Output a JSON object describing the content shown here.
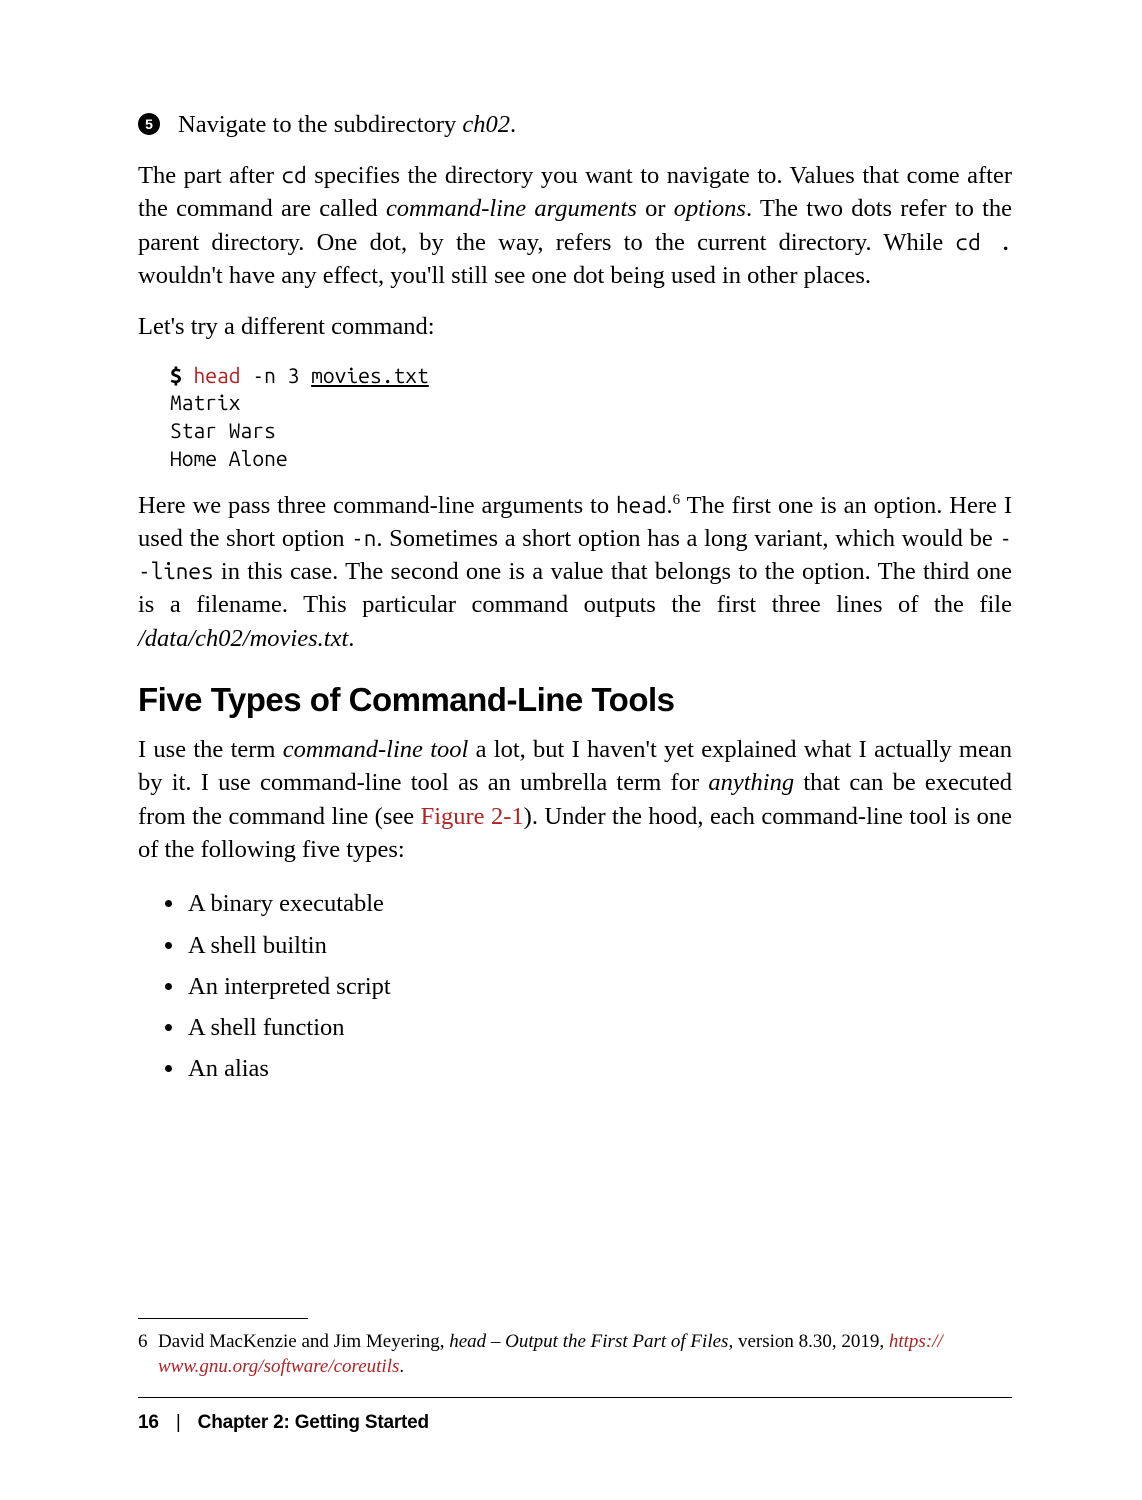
{
  "callout": {
    "number": "5",
    "text_before": "Navigate to the subdirectory ",
    "em": "ch02",
    "text_after": "."
  },
  "p1": {
    "seg1": "The part after ",
    "code1": "cd",
    "seg2": " specifies the directory you want to navigate to. Values that come after the command are called ",
    "em1": "command-line arguments",
    "seg3": " or ",
    "em2": "options",
    "seg4": ". The two dots refer to the parent directory. One dot, by the way, refers to the current directory. While ",
    "code2": "cd .",
    "seg5": " wouldn't have any effect, you'll still see one dot being used in other places."
  },
  "p2": "Let's try a different command:",
  "code": {
    "prompt": "$",
    "cmd": "head",
    "args_pre": " -n 3 ",
    "file": "movies.txt",
    "out1": "Matrix",
    "out2": "Star Wars",
    "out3": "Home Alone"
  },
  "p3": {
    "seg1": "Here we pass three command-line arguments to ",
    "code1": "head",
    "seg2": ".",
    "fnref": "6",
    "seg3": " The first one is an option. Here I used the short option ",
    "code2": "-n",
    "seg4": ". Sometimes a short option has a long variant, which would be ",
    "code3": "--lines",
    "seg5": " in this case. The second one is a value that belongs to the option. The third one is a filename. This particular command outputs the first three lines of the file ",
    "em1": "/data/ch02/movies.txt",
    "seg6": "."
  },
  "h2": "Five Types of Command-Line Tools",
  "p4": {
    "seg1": "I use the term ",
    "em1": "command-line tool",
    "seg2": " a lot, but I haven't yet explained what I actually mean by it. I use command-line tool as an umbrella term for ",
    "em2": "anything",
    "seg3": " that can be executed from the command line (see ",
    "link": "Figure 2-1",
    "seg4": "). Under the hood, each command-line tool is one of the following five types:"
  },
  "types": [
    "A binary executable",
    "A shell builtin",
    "An interpreted script",
    "A shell function",
    "An alias"
  ],
  "footnote": {
    "num": "6",
    "seg1": "David MacKenzie and Jim Meyering, ",
    "em1": "head – Output the First Part of Files",
    "seg2": ", version 8.30, 2019, ",
    "link1": "https://",
    "link2": "www.gnu.org/software/coreutils",
    "seg3": "."
  },
  "footer": {
    "page": "16",
    "sep": "|",
    "chapter": "Chapter 2: Getting Started"
  }
}
